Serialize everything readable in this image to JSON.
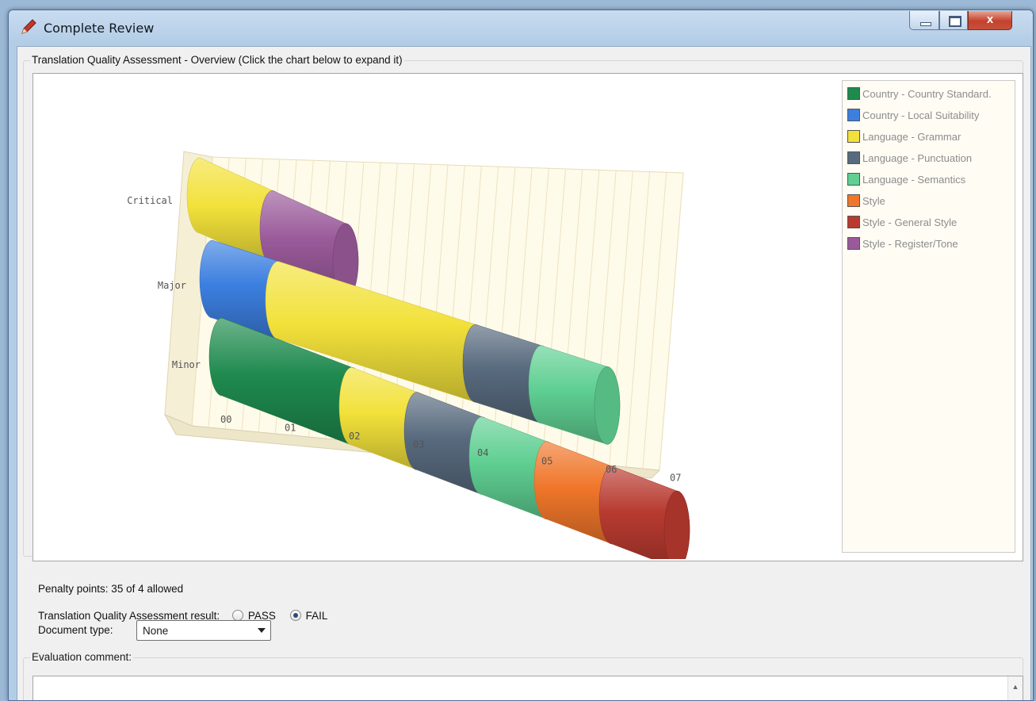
{
  "window": {
    "title": "Complete Review",
    "close_glyph": "x"
  },
  "chart_group": {
    "legend": "Translation Quality Assessment - Overview (Click the chart below to expand it)"
  },
  "chart_data": {
    "type": "bar",
    "orientation": "horizontal",
    "stacked": true,
    "style": "3d-cylinder",
    "categories": [
      "Critical",
      "Major",
      "Minor"
    ],
    "x_ticks": [
      "00",
      "01",
      "02",
      "03",
      "04",
      "05",
      "06",
      "07"
    ],
    "xlim": [
      0,
      7
    ],
    "grid": true,
    "legend_position": "right",
    "series": [
      {
        "name": "Country - Country Standard.",
        "color": "#1e8a4e",
        "values": [
          0,
          0,
          2
        ]
      },
      {
        "name": "Country - Local Suitability",
        "color": "#3c7fe0",
        "values": [
          0,
          1,
          0
        ]
      },
      {
        "name": "Language - Grammar",
        "color": "#f2e13a",
        "values": [
          1,
          3,
          1
        ]
      },
      {
        "name": "Language - Punctuation",
        "color": "#586a7e",
        "values": [
          0,
          1,
          1
        ]
      },
      {
        "name": "Language - Semantics",
        "color": "#5fcf92",
        "values": [
          0,
          1,
          1
        ]
      },
      {
        "name": "Style",
        "color": "#f0762a",
        "values": [
          0,
          0,
          1
        ]
      },
      {
        "name": "Style - General Style",
        "color": "#b83a30",
        "values": [
          0,
          0,
          1
        ]
      },
      {
        "name": "Style - Register/Tone",
        "color": "#9a5a9a",
        "values": [
          1,
          0,
          0
        ]
      }
    ],
    "minor_order": [
      "Country - Country Standard.",
      "Language - Grammar",
      "Language - Punctuation",
      "Language - Semantics",
      "Style",
      "Style - General Style"
    ]
  },
  "penalty": {
    "text": "Penalty points: 35 of 4 allowed"
  },
  "result": {
    "label": "Translation Quality Assessment result:",
    "options": [
      {
        "label": "PASS",
        "selected": false
      },
      {
        "label": "FAIL",
        "selected": true
      }
    ]
  },
  "document_type": {
    "label": "Document type:",
    "value": "None"
  },
  "comment": {
    "legend": "Evaluation comment:",
    "value": ""
  }
}
